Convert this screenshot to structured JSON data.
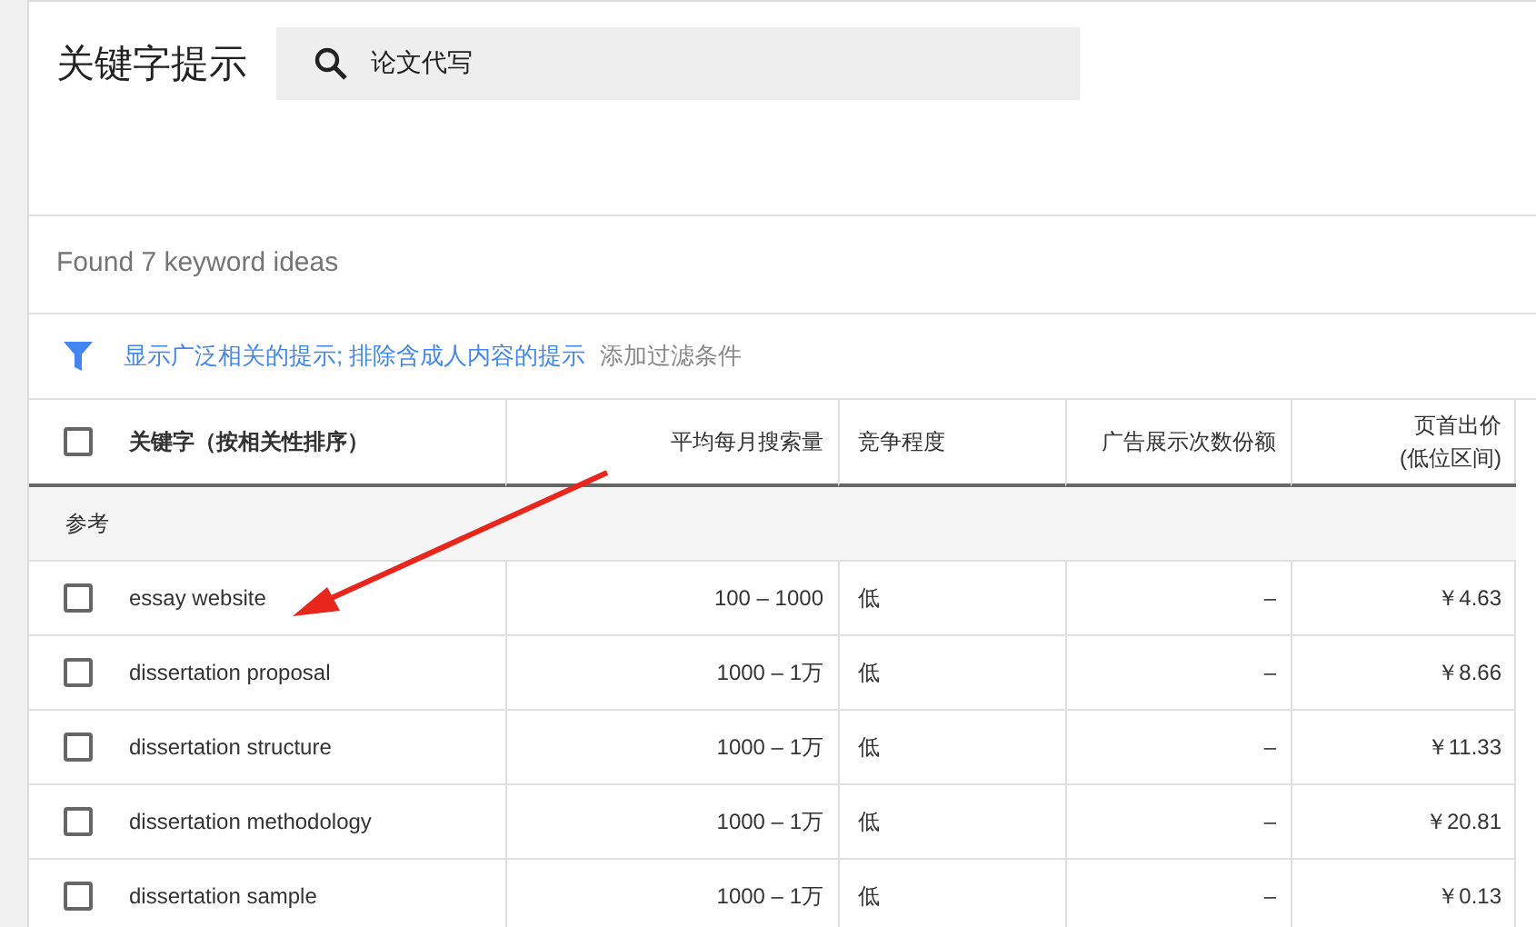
{
  "title": "关键字提示",
  "search": {
    "value": "论文代写"
  },
  "result_count": "Found 7 keyword ideas",
  "filters": {
    "active": "显示广泛相关的提示; 排除含成人内容的提示",
    "add": "添加过滤条件"
  },
  "table": {
    "select_all": {
      "checked": false
    },
    "columns": [
      "关键字（按相关性排序）",
      "平均每月搜索量",
      "竞争程度",
      "广告展示次数份额",
      "页首出价\n(低位区间)"
    ],
    "group": "参考",
    "rows": [
      {
        "checked": false,
        "cells": [
          "essay website",
          "100 – 1000",
          "低",
          "–",
          "￥4.63"
        ]
      },
      {
        "checked": false,
        "cells": [
          "dissertation proposal",
          "1000 – 1万",
          "低",
          "–",
          "￥8.66"
        ]
      },
      {
        "checked": false,
        "cells": [
          "dissertation structure",
          "1000 – 1万",
          "低",
          "–",
          "￥11.33"
        ]
      },
      {
        "checked": false,
        "cells": [
          "dissertation methodology",
          "1000 – 1万",
          "低",
          "–",
          "￥20.81"
        ]
      },
      {
        "checked": false,
        "cells": [
          "dissertation sample",
          "1000 – 1万",
          "低",
          "–",
          "￥0.13"
        ]
      }
    ]
  }
}
